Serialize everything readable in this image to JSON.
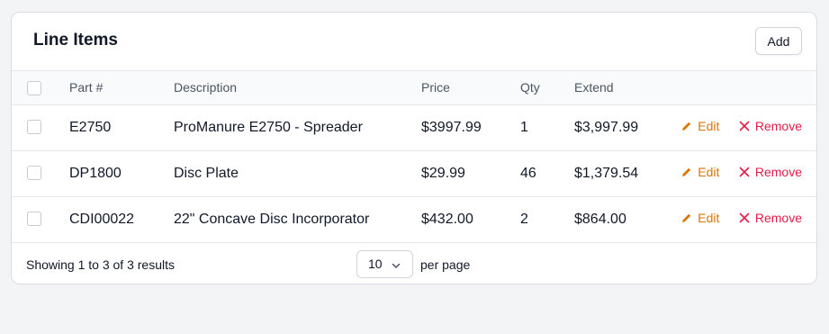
{
  "card": {
    "title": "Line Items",
    "add_label": "Add"
  },
  "table": {
    "headers": {
      "part": "Part #",
      "description": "Description",
      "price": "Price",
      "qty": "Qty",
      "extend": "Extend"
    },
    "rows": [
      {
        "part": "E2750",
        "description": "ProManure E2750 - Spreader",
        "price": "$3997.99",
        "qty": "1",
        "extend": "$3,997.99",
        "edit": "Edit",
        "remove": "Remove"
      },
      {
        "part": "DP1800",
        "description": "Disc Plate",
        "price": "$29.99",
        "qty": "46",
        "extend": "$1,379.54",
        "edit": "Edit",
        "remove": "Remove"
      },
      {
        "part": "CDI00022",
        "description": "22\" Concave Disc Incorporator",
        "price": "$432.00",
        "qty": "2",
        "extend": "$864.00",
        "edit": "Edit",
        "remove": "Remove"
      }
    ]
  },
  "footer": {
    "summary": "Showing 1 to 3 of 3 results",
    "per_page_value": "10",
    "per_page_label": "per page"
  },
  "icons": {
    "edit": "pencil-icon",
    "remove": "x-icon",
    "select": "chevron-down-icon"
  },
  "colors": {
    "edit": "#d97706",
    "remove": "#e11d48",
    "background": "#f3f4f6"
  }
}
